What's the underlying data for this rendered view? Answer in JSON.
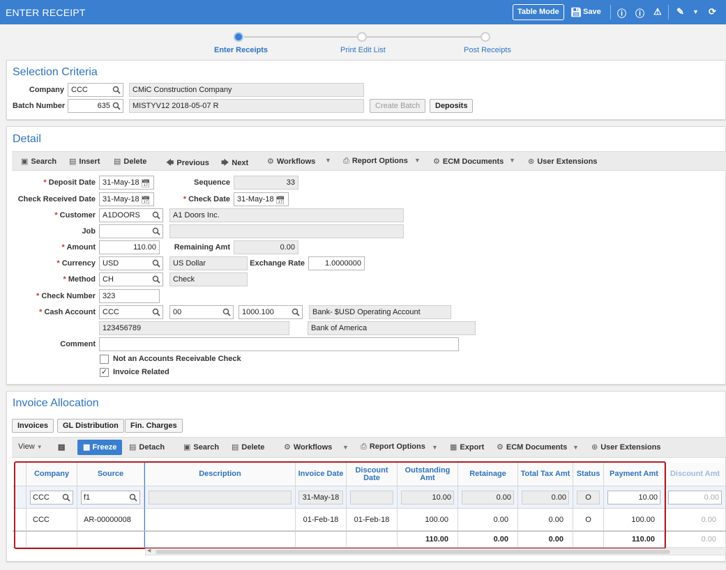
{
  "app": {
    "title": "ENTER RECEIPT",
    "table_mode": "Table Mode",
    "save": "Save"
  },
  "steps": [
    "Enter Receipts",
    "Print Edit List",
    "Post Receipts"
  ],
  "selection": {
    "title": "Selection Criteria",
    "company_label": "Company",
    "company": "CCC",
    "company_name": "CMiC Construction Company",
    "batch_label": "Batch Number",
    "batch": "635",
    "batch_desc": "MISTYV12 2018-05-07 R",
    "create_batch": "Create Batch",
    "deposits": "Deposits"
  },
  "detail": {
    "title": "Detail",
    "toolbar": {
      "search": "Search",
      "insert": "Insert",
      "delete": "Delete",
      "previous": "Previous",
      "next": "Next",
      "workflows": "Workflows",
      "report_options": "Report Options",
      "ecm": "ECM Documents",
      "user_ext": "User Extensions"
    },
    "deposit_date_label": "Deposit Date",
    "deposit_date": "31-May-18",
    "sequence_label": "Sequence",
    "sequence": "33",
    "check_received_label": "Check Received Date",
    "check_received": "31-May-18",
    "check_date_label": "Check Date",
    "check_date": "31-May-18",
    "customer_label": "Customer",
    "customer": "A1DOORS",
    "customer_name": "A1 Doors Inc.",
    "job_label": "Job",
    "job": "",
    "job_name": "",
    "amount_label": "Amount",
    "amount": "110.00",
    "remaining_label": "Remaining Amt",
    "remaining": "0.00",
    "currency_label": "Currency",
    "currency": "USD",
    "currency_name": "US Dollar",
    "exchange_label": "Exchange Rate",
    "exchange": "1.0000000",
    "method_label": "Method",
    "method": "CH",
    "method_name": "Check",
    "check_number_label": "Check Number",
    "check_number": "323",
    "cash_account_label": "Cash Account",
    "cash_company": "CCC",
    "cash_dept": "00",
    "cash_account": "1000.100",
    "cash_account_name": "Bank- $USD Operating Account",
    "bank_account": "123456789",
    "bank_name": "Bank of America",
    "comment_label": "Comment",
    "comment": "",
    "not_ar_label": "Not an Accounts Receivable Check",
    "invoice_related_label": "Invoice Related"
  },
  "allocation": {
    "title": "Invoice Allocation",
    "tabs": [
      "Invoices",
      "GL Distribution",
      "Fin. Charges"
    ],
    "toolbar": {
      "view": "View",
      "freeze": "Freeze",
      "detach": "Detach",
      "search": "Search",
      "delete": "Delete",
      "workflows": "Workflows",
      "report_options": "Report Options",
      "export": "Export",
      "ecm": "ECM Documents",
      "user_ext": "User Extensions"
    },
    "columns": [
      "Company",
      "Source",
      "Description",
      "Invoice Date",
      "Discount Date",
      "Outstanding Amt",
      "Retainage",
      "Total Tax Amt",
      "Status",
      "Payment Amt",
      "Discount Amt"
    ],
    "filter": {
      "company": "CCC",
      "source": "f1",
      "description": "",
      "invoice_date": "31-May-18",
      "discount_date": "",
      "outstanding": "10.00",
      "retainage": "0.00",
      "tax": "0.00",
      "status": "O",
      "payment": "10.00",
      "discount": "0.00"
    },
    "row": {
      "company": "CCC",
      "source": "AR-00000008",
      "description": "",
      "invoice_date": "01-Feb-18",
      "discount_date": "01-Feb-18",
      "outstanding": "100.00",
      "retainage": "0.00",
      "tax": "0.00",
      "status": "O",
      "payment": "100.00",
      "discount": "0.00"
    },
    "totals": {
      "outstanding": "110.00",
      "retainage": "0.00",
      "tax": "0.00",
      "payment": "110.00",
      "discount": "0.00"
    }
  }
}
